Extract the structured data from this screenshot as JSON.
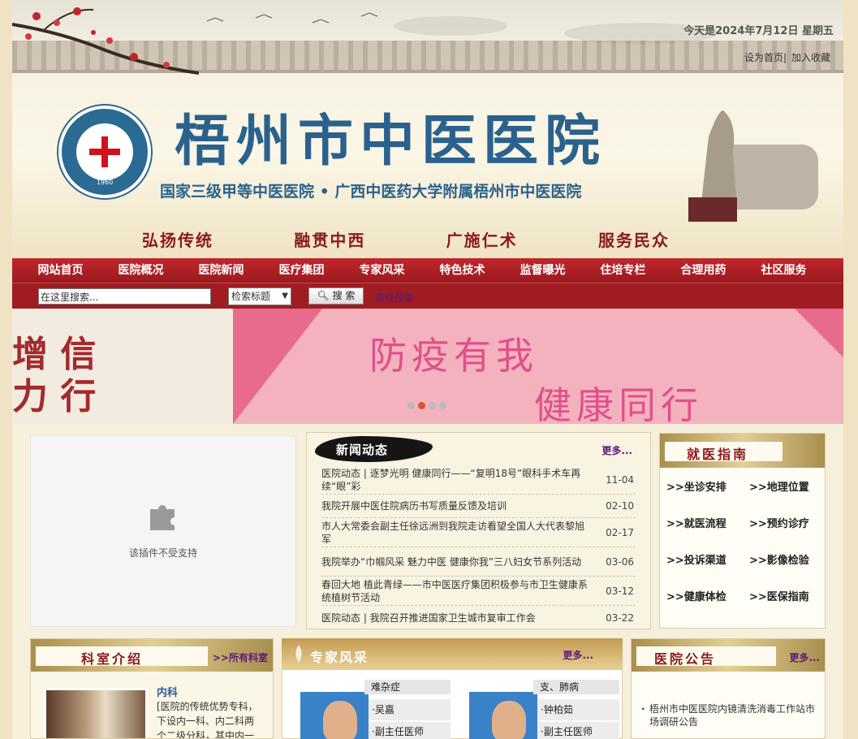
{
  "header": {
    "date_text": "今天是2024年7月12日  星期五",
    "top_links": [
      "设为首页",
      "加入收藏"
    ],
    "hospital_name": "梧州市中医医院",
    "hospital_subtitle": "国家三级甲等中医医院 • 广西中医药大学附属梧州市中医医院",
    "slogans": [
      "弘扬传统",
      "融贯中西",
      "广施仁术",
      "服务民众"
    ],
    "logo_year": "1960"
  },
  "nav": {
    "items": [
      "网站首页",
      "医院概况",
      "医院新闻",
      "医疗集团",
      "专家风采",
      "特色技术",
      "监督曝光",
      "住培专栏",
      "合理用药",
      "社区服务"
    ]
  },
  "search": {
    "input_value": "在这里搜索...",
    "select_value": "检索标题",
    "button_label": "搜 索",
    "advanced_label": "高级搜索"
  },
  "banner": {
    "left_line1": "增  信",
    "left_line2": "力  行",
    "line1": "防疫有我",
    "line2": "健康同行",
    "slide_count": 4,
    "active_slide": 2
  },
  "plugin": {
    "message": "该插件不受支持"
  },
  "news": {
    "title": "新闻动态",
    "more_label": "更多...",
    "items": [
      {
        "title": "医院动态 | 逐梦光明 健康同行——“复明18号”眼科手术车再续“眼”彩",
        "date": "11-04"
      },
      {
        "title": "我院开展中医住院病历书写质量反馈及培训",
        "date": "02-10"
      },
      {
        "title": "市人大常委会副主任徐远洲到我院走访看望全国人大代表黎旭军",
        "date": "02-17"
      },
      {
        "title": "我院举办“巾帼风采 魅力中医 健康你我”三八妇女节系列活动",
        "date": "03-06"
      },
      {
        "title": "春回大地 植此青绿——市中医医疗集团积极参与市卫生健康系统植树节活动",
        "date": "03-12"
      },
      {
        "title": "医院动态 | 我院召开推进国家卫生城市复审工作会",
        "date": "03-22"
      }
    ]
  },
  "guide": {
    "title": "就医指南",
    "links": [
      ">>坐诊安排",
      ">>地理位置",
      ">>就医流程",
      ">>预约诊疗",
      ">>投诉渠道",
      ">>影像检验",
      ">>健康体检",
      ">>医保指南"
    ]
  },
  "departments": {
    "title": "科室介绍",
    "more_label": ">>所有科室",
    "dept_name": "内科",
    "dept_desc": "[医院的传统优势专科，下设内一科、内二科两个二级分科，其中内一"
  },
  "experts": {
    "title": "专家风采",
    "more_label": "更多...",
    "cards": [
      {
        "tag": "难杂症",
        "name": "·吴嘉",
        "rank": "·副主任医师"
      },
      {
        "tag": "支、肺病",
        "name": "·钟柏茹",
        "rank": "·副主任医师"
      }
    ]
  },
  "notice": {
    "title": "医院公告",
    "more_label": "更多...",
    "items": [
      "梧州市中医医院内镜清洗消毒工作站市场调研公告"
    ]
  },
  "colors": {
    "nav_red": "#b3222a",
    "brand_blue": "#2a628d",
    "title_red": "#8a1a1a",
    "link_purple": "#5a1a7a"
  }
}
